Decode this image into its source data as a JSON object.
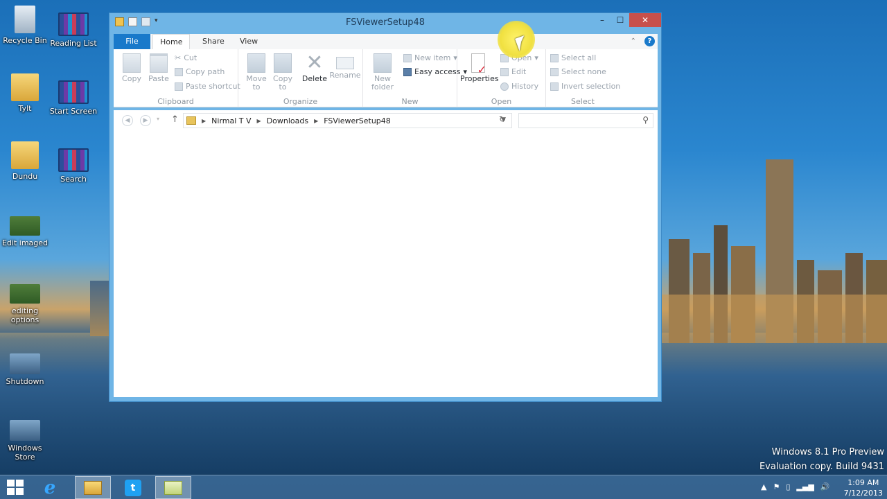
{
  "desktop": {
    "icons": [
      {
        "label": "Recycle Bin"
      },
      {
        "label": "Reading List"
      },
      {
        "label": "Tylt"
      },
      {
        "label": "Start Screen"
      },
      {
        "label": "Dundu"
      },
      {
        "label": "Search"
      },
      {
        "label": "Edit imaged"
      },
      {
        "label": "editing options"
      },
      {
        "label": "Shutdown"
      },
      {
        "label": "Windows Store"
      }
    ],
    "watermark": {
      "line1": "Windows 8.1 Pro Preview",
      "line2": "Evaluation copy. Build 9431"
    }
  },
  "window": {
    "title": "FSViewerSetup48",
    "controls": {
      "minimize": "–",
      "maximize": "☐",
      "close": "✕"
    },
    "tabs": {
      "file": "File",
      "home": "Home",
      "share": "Share",
      "view": "View"
    },
    "help": "?",
    "ribbon": {
      "clipboard": {
        "label": "Clipboard",
        "copy": "Copy",
        "paste": "Paste",
        "cut": "Cut",
        "copy_path": "Copy path",
        "paste_shortcut": "Paste shortcut"
      },
      "organize": {
        "label": "Organize",
        "move_to": "Move to",
        "copy_to": "Copy to",
        "delete": "Delete",
        "rename": "Rename"
      },
      "new": {
        "label": "New",
        "new_folder": "New folder",
        "new_item": "New item",
        "easy_access": "Easy access"
      },
      "open": {
        "label": "Open",
        "properties": "Properties",
        "open": "Open",
        "edit": "Edit",
        "history": "History"
      },
      "select": {
        "label": "Select",
        "select_all": "Select all",
        "select_none": "Select none",
        "invert_selection": "Invert selection"
      }
    },
    "address": {
      "path": [
        "Nirmal T V",
        "Downloads",
        "FSViewerSetup48"
      ],
      "search_placeholder": ""
    }
  },
  "taskbar": {
    "time": "1:09 AM",
    "date": "7/12/2013"
  }
}
